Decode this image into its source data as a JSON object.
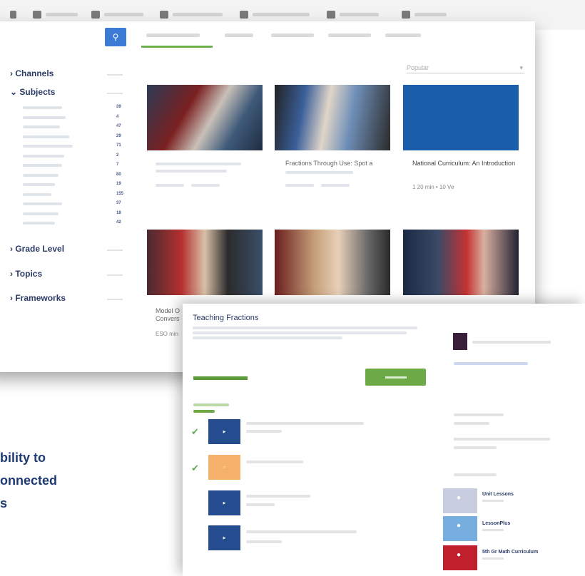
{
  "sidebar": {
    "channels_label": "Channels",
    "subjects_label": "Subjects",
    "subject_counts": [
      "39",
      "4",
      "47",
      "29",
      "71",
      "2",
      "7",
      "80",
      "19",
      "155",
      "37",
      "18",
      "42"
    ],
    "grade_level_label": "Grade Level",
    "topics_label": "Topics",
    "frameworks_label": "Frameworks"
  },
  "sort": {
    "label": "Popular"
  },
  "videos": [
    {
      "title": "",
      "meta": ""
    },
    {
      "title": "Fractions Through Use: Spot a",
      "meta": ""
    },
    {
      "title": "National Curriculum: An Introduction",
      "meta": "1 20 min  •  10 Ve"
    },
    {
      "title": "Model O Convers",
      "meta": "ESO min"
    },
    {
      "title": "",
      "meta": ""
    },
    {
      "title": "",
      "meta": ""
    }
  ],
  "popup": {
    "title": "Teaching Fractions"
  },
  "related_cards": [
    {
      "title": "Unit Lessons"
    },
    {
      "title": "LessonPlus"
    },
    {
      "title": "5th Gr Math Curriculum"
    }
  ],
  "overlay_lines": [
    "bility to",
    "onnected",
    "s"
  ],
  "colors": {
    "accent": "#3b7bd6",
    "green": "#6da946",
    "navy": "#2a3b66"
  }
}
